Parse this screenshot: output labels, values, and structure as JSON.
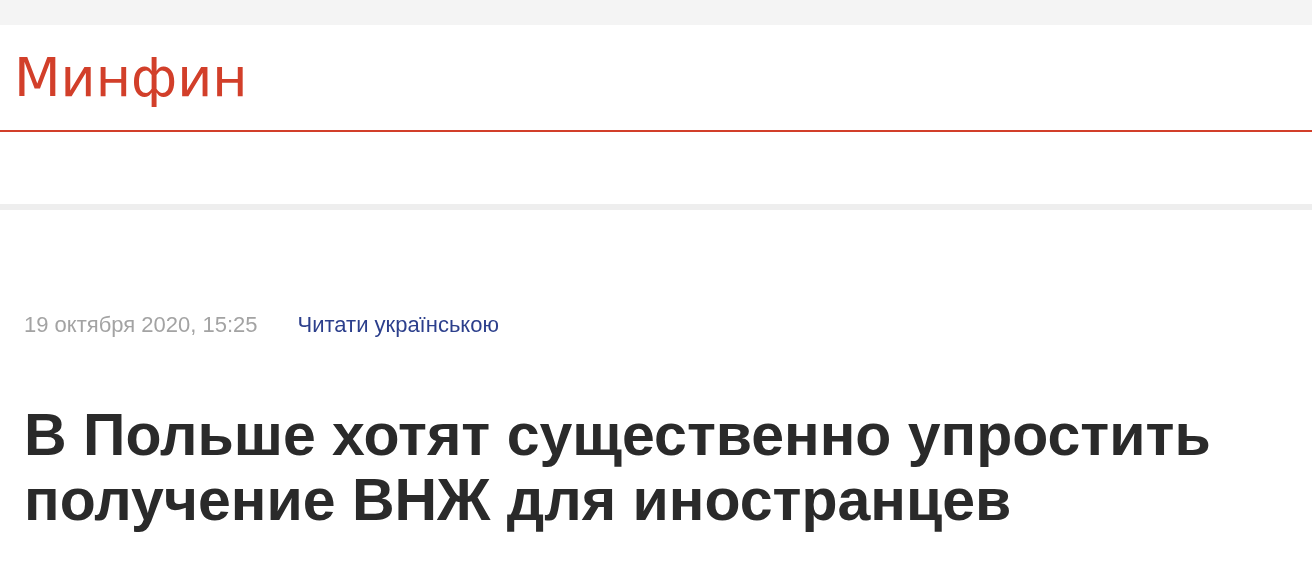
{
  "header": {
    "logo": "Минфин"
  },
  "article": {
    "date": "19 октября 2020, 15:25",
    "language_link": "Читати українською",
    "headline": "В Польше хотят существенно упростить получение ВНЖ для иностранцев"
  }
}
